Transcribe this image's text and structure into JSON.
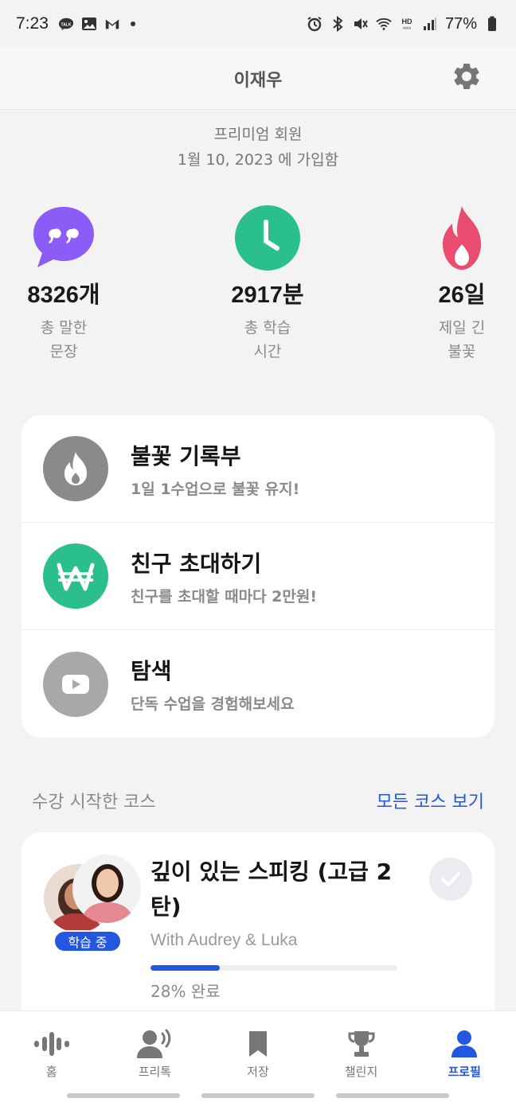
{
  "status_bar": {
    "time": "7:23",
    "battery": "77%",
    "left_icons": [
      "talk-icon",
      "gallery-icon",
      "gmail-icon"
    ],
    "right_icons": [
      "alarm-icon",
      "bluetooth-icon",
      "mute-icon",
      "wifi-icon",
      "hd-voice-icon",
      "signal-icon",
      "battery-icon"
    ]
  },
  "header": {
    "title": "이재우",
    "settings_icon": "gear-icon"
  },
  "membership": {
    "tier": "프리미엄 회원",
    "joined": "1월 10, 2023  에 가입함"
  },
  "stats": [
    {
      "value": "8326개",
      "label_line1": "총 말한",
      "label_line2": "문장",
      "icon": "quote-bubble-icon",
      "color": "#8b5cf6"
    },
    {
      "value": "2917분",
      "label_line1": "총 학습",
      "label_line2": "시간",
      "icon": "clock-icon",
      "color": "#2bbf8e"
    },
    {
      "value": "26일",
      "label_line1": "제일 긴",
      "label_line2": "불꽃",
      "icon": "flame-icon",
      "color": "#ea4c6f"
    }
  ],
  "menu": [
    {
      "title": "불꽃 기록부",
      "subtitle": "1일 1수업으로 불꽃 유지!",
      "icon": "flame-icon",
      "color": "#8a8a8a"
    },
    {
      "title": "친구 초대하기",
      "subtitle": "친구를 초대할 때마다 2만원!",
      "icon": "won-icon",
      "color": "#2bbf8e"
    },
    {
      "title": "탐색",
      "subtitle": "단독 수업을 경험해보세요",
      "icon": "play-icon",
      "color": "#a8a8a8"
    }
  ],
  "courses": {
    "section_title": "수강 시작한 코스",
    "view_all": "모든 코스 보기",
    "items": [
      {
        "title": "깊이 있는 스피킹 (고급 2탄)",
        "instructors": "With Audrey & Luka",
        "badge": "학습 중",
        "progress": 0.28,
        "progress_text": "28% 완료"
      }
    ]
  },
  "bottom_nav": [
    {
      "label": "홈",
      "icon": "voice-wave-icon",
      "active": false
    },
    {
      "label": "프리톡",
      "icon": "speaking-person-icon",
      "active": false
    },
    {
      "label": "저장",
      "icon": "bookmark-icon",
      "active": false
    },
    {
      "label": "챌린지",
      "icon": "trophy-icon",
      "active": false
    },
    {
      "label": "프로필",
      "icon": "person-icon",
      "active": true
    }
  ],
  "colors": {
    "accent": "#2457e0",
    "background": "#f3f3f3"
  }
}
